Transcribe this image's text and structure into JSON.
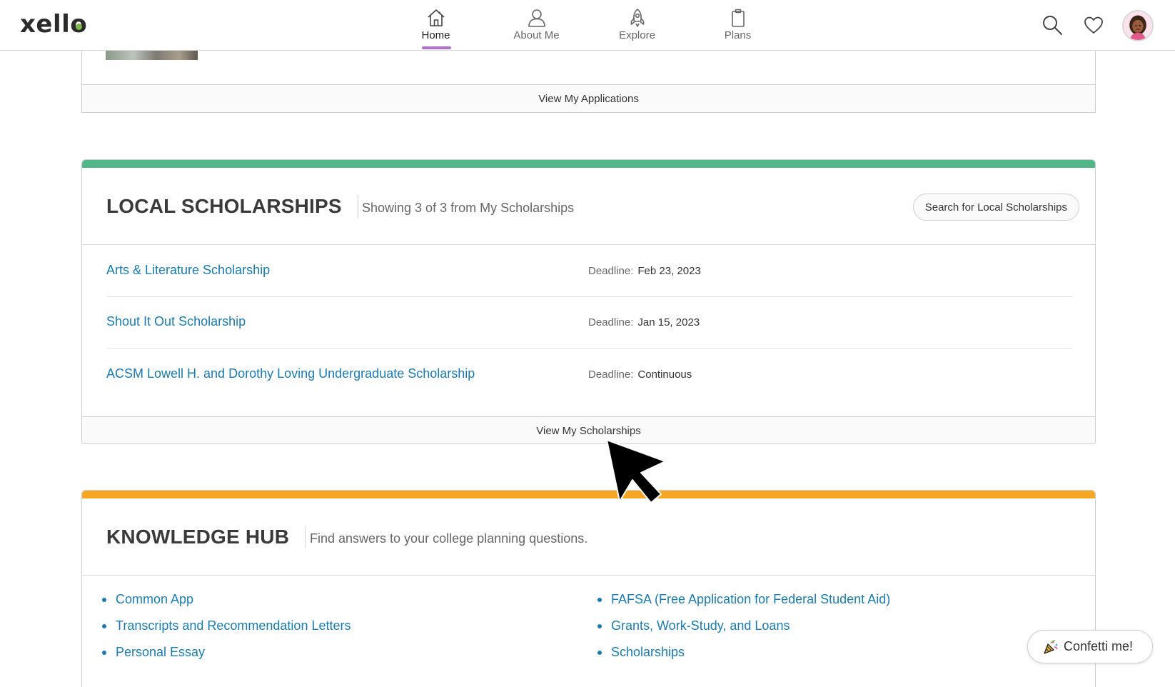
{
  "header": {
    "logo": "xello",
    "nav": [
      {
        "label": "Home",
        "icon": "home-icon",
        "active": true
      },
      {
        "label": "About Me",
        "icon": "person-icon",
        "active": false
      },
      {
        "label": "Explore",
        "icon": "rocket-icon",
        "active": false
      },
      {
        "label": "Plans",
        "icon": "clipboard-icon",
        "active": false
      }
    ],
    "icons": [
      "search-icon",
      "heart-icon"
    ],
    "accent_color": "#b06fd0"
  },
  "applications_card": {
    "footer_link": "View My Applications"
  },
  "local_scholarships": {
    "title": "LOCAL SCHOLARSHIPS",
    "subtitle": "Showing 3 of 3 from My Scholarships",
    "search_button": "Search for Local Scholarships",
    "accent_color": "#52b788",
    "deadline_label": "Deadline:",
    "items": [
      {
        "name": "Arts & Literature Scholarship",
        "deadline": "Feb 23, 2023"
      },
      {
        "name": "Shout It Out Scholarship",
        "deadline": "Jan 15, 2023"
      },
      {
        "name": "ACSM Lowell H. and Dorothy Loving Undergraduate Scholarship",
        "deadline": "Continuous"
      }
    ],
    "footer_link": "View My Scholarships"
  },
  "knowledge_hub": {
    "title": "KNOWLEDGE HUB",
    "subtitle": "Find answers to your college planning questions.",
    "accent_color": "#f5a623",
    "left_links": [
      "Common App",
      "Transcripts and Recommendation Letters",
      "Personal Essay"
    ],
    "right_links": [
      "FAFSA (Free Application for Federal Student Aid)",
      "Grants, Work-Study, and Loans",
      "Scholarships"
    ]
  },
  "confetti_button": {
    "label": "Confetti me!",
    "icon": "party-popper-icon"
  },
  "link_color": "#1a7bb0"
}
